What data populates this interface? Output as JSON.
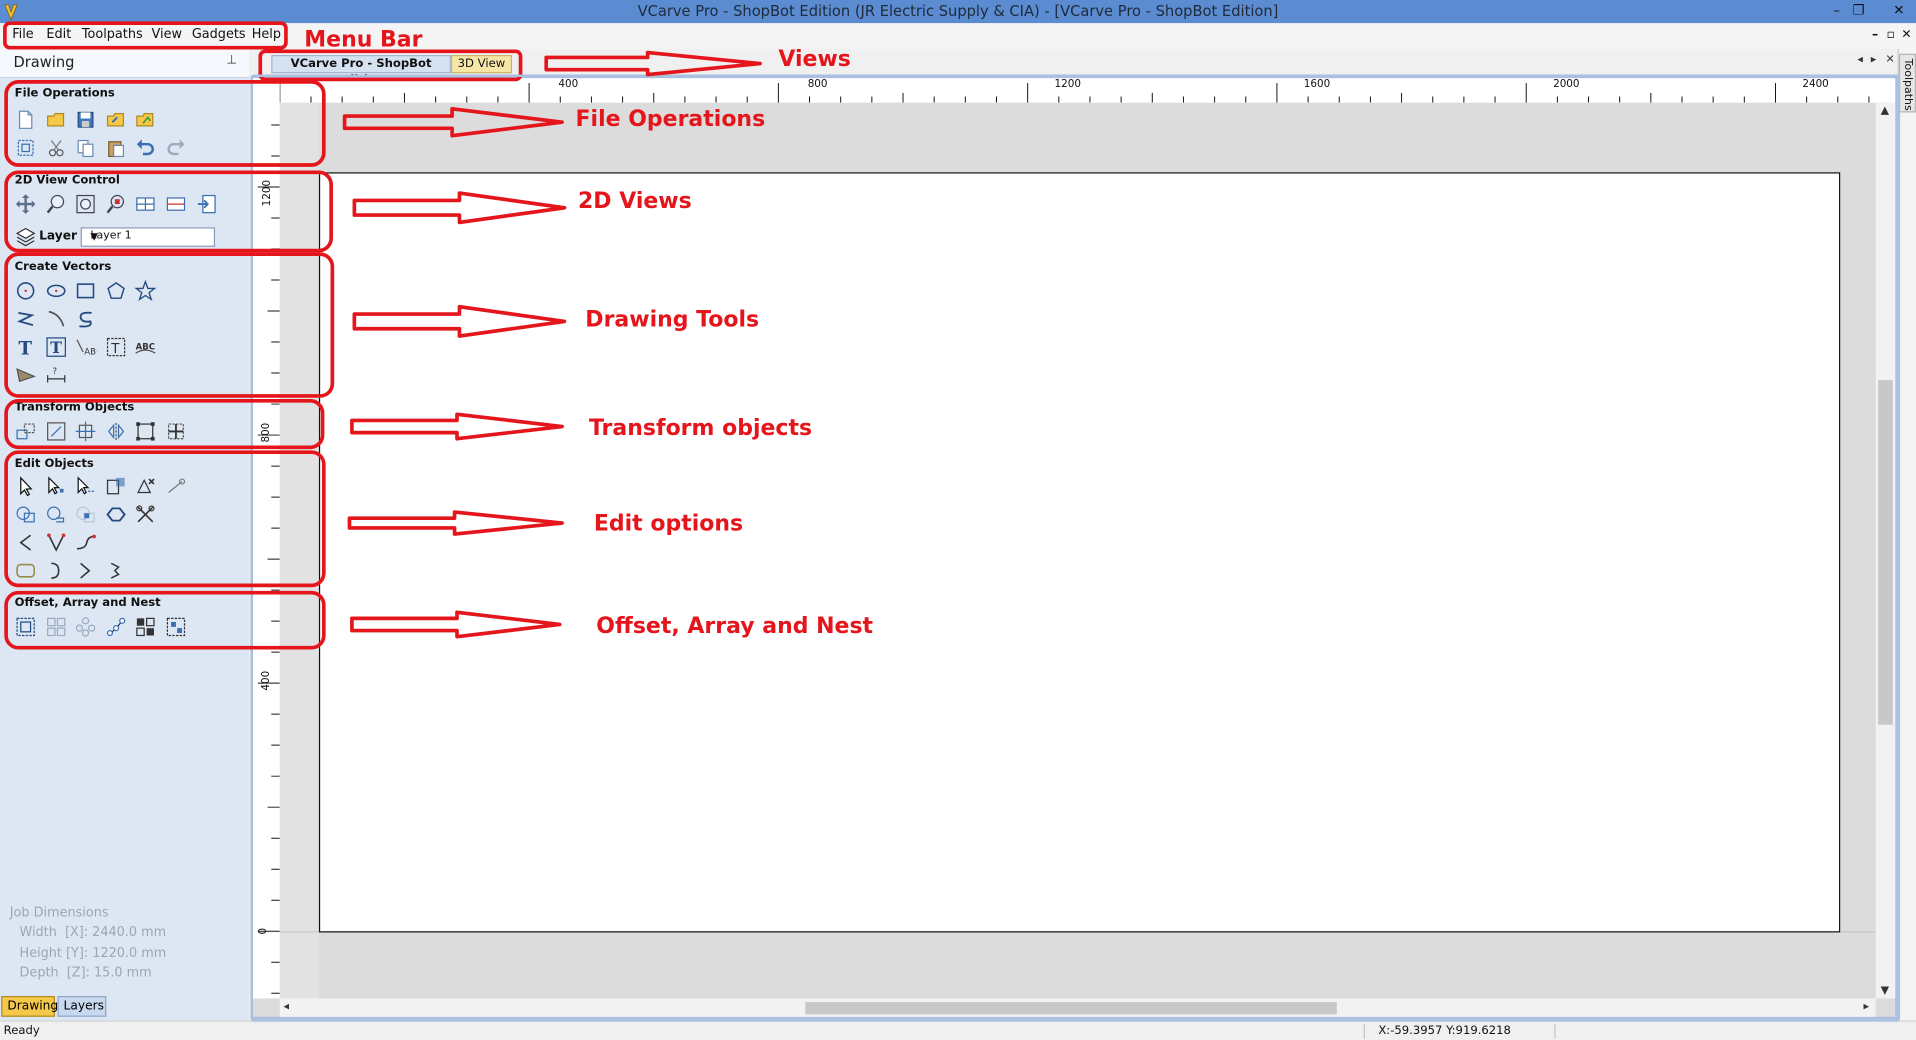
{
  "window": {
    "title": "VCarve Pro - ShopBot Edition (JR Electric Supply & CIA) - [VCarve Pro - ShopBot Edition]",
    "minimize": "–",
    "restore": "❐",
    "close": "✕",
    "mdi_restore": "🗗",
    "mdi_close": "✕",
    "mdi_min": "–"
  },
  "menu": {
    "items": [
      "File",
      "Edit",
      "Toolpaths",
      "View",
      "Gadgets",
      "Help"
    ]
  },
  "panel": {
    "title": "Drawing",
    "pin": "📌",
    "sections": {
      "file_operations": "File Operations",
      "view_control": "2D View Control",
      "create_vectors": "Create Vectors",
      "transform_objects": "Transform Objects",
      "edit_objects": "Edit Objects",
      "offset_array_nest": "Offset, Array and Nest"
    },
    "layer_label": "Layer",
    "layer_value": "Layer 1",
    "job_dimensions": {
      "title": "Job Dimensions",
      "width": "Width  [X]: 2440.0 mm",
      "height": "Height [Y]: 1220.0 mm",
      "depth": "Depth  [Z]: 15.0 mm"
    },
    "bottom_tabs": [
      "Drawing",
      "Layers"
    ]
  },
  "views": {
    "tab_2d": "VCarve Pro - ShopBot Edition",
    "tab_3d": "3D View"
  },
  "ruler": {
    "top_labels": [
      "400",
      "800",
      "1200",
      "1600",
      "2000",
      "2400"
    ],
    "left_labels": [
      "1200",
      "800",
      "400",
      "0"
    ]
  },
  "right_tab": "Toolpaths",
  "status": {
    "ready": "Ready",
    "coords": "X:-59.3957 Y:919.6218"
  },
  "annotations": {
    "menu_bar": "Menu Bar",
    "views": "Views",
    "file_operations": "File Operations",
    "views_2d": "2D Views",
    "drawing_tools": "Drawing Tools",
    "transform_objects": "Transform objects",
    "edit_options": "Edit options",
    "offset_array_nest": "Offset, Array and Nest"
  },
  "colors": {
    "title_bar": "#5b8cd1",
    "annotation_red": "#e4161c",
    "panel_bg": "#dde7f4",
    "tab_3d": "#f7e7a6"
  }
}
